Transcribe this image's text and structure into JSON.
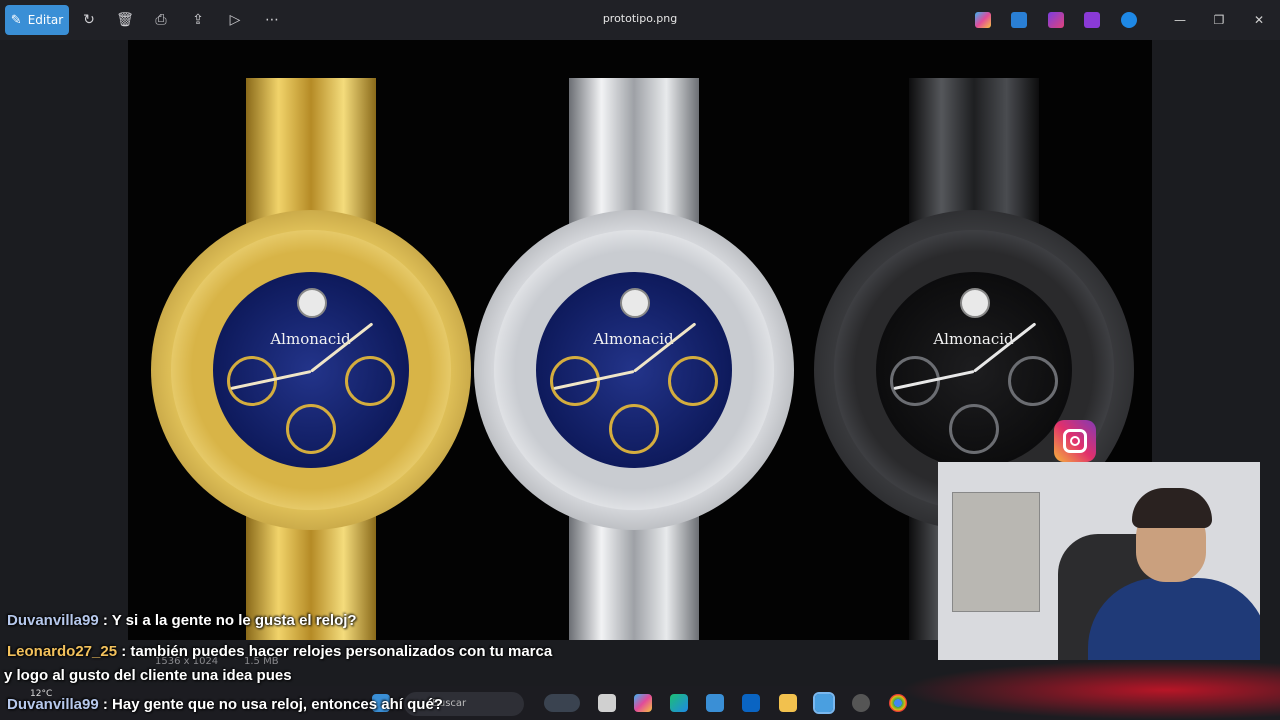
{
  "toolbar": {
    "edit_label": "Editar",
    "file_title": "prototipo.png"
  },
  "photo": {
    "brand_name": "Almonacid",
    "watches": [
      "gold",
      "silver",
      "black"
    ]
  },
  "chat": {
    "messages": [
      {
        "user": "Duvanvilla99",
        "text": ": Y si a la gente no le gusta el reloj?"
      },
      {
        "user": "Leonardo27_25",
        "text": ": también puedes hacer relojes personalizados con tu marca"
      },
      {
        "user": "",
        "text": "y logo al gusto del cliente una idea pues"
      },
      {
        "user": "Duvanvilla99",
        "text": ": Hay gente que no usa reloj, entonces ahí qué?"
      }
    ]
  },
  "status": {
    "dimensions": "1536 x 1024",
    "size": "1.5 MB"
  },
  "taskbar": {
    "search_placeholder": "Buscar",
    "weather": "12°C"
  },
  "colors": {
    "accent": "#3a8fd6",
    "gold": "#d6ae3a",
    "silver": "#c9ccd1",
    "black": "#2a2a2c",
    "dial_blue": "#0e1a5c"
  }
}
